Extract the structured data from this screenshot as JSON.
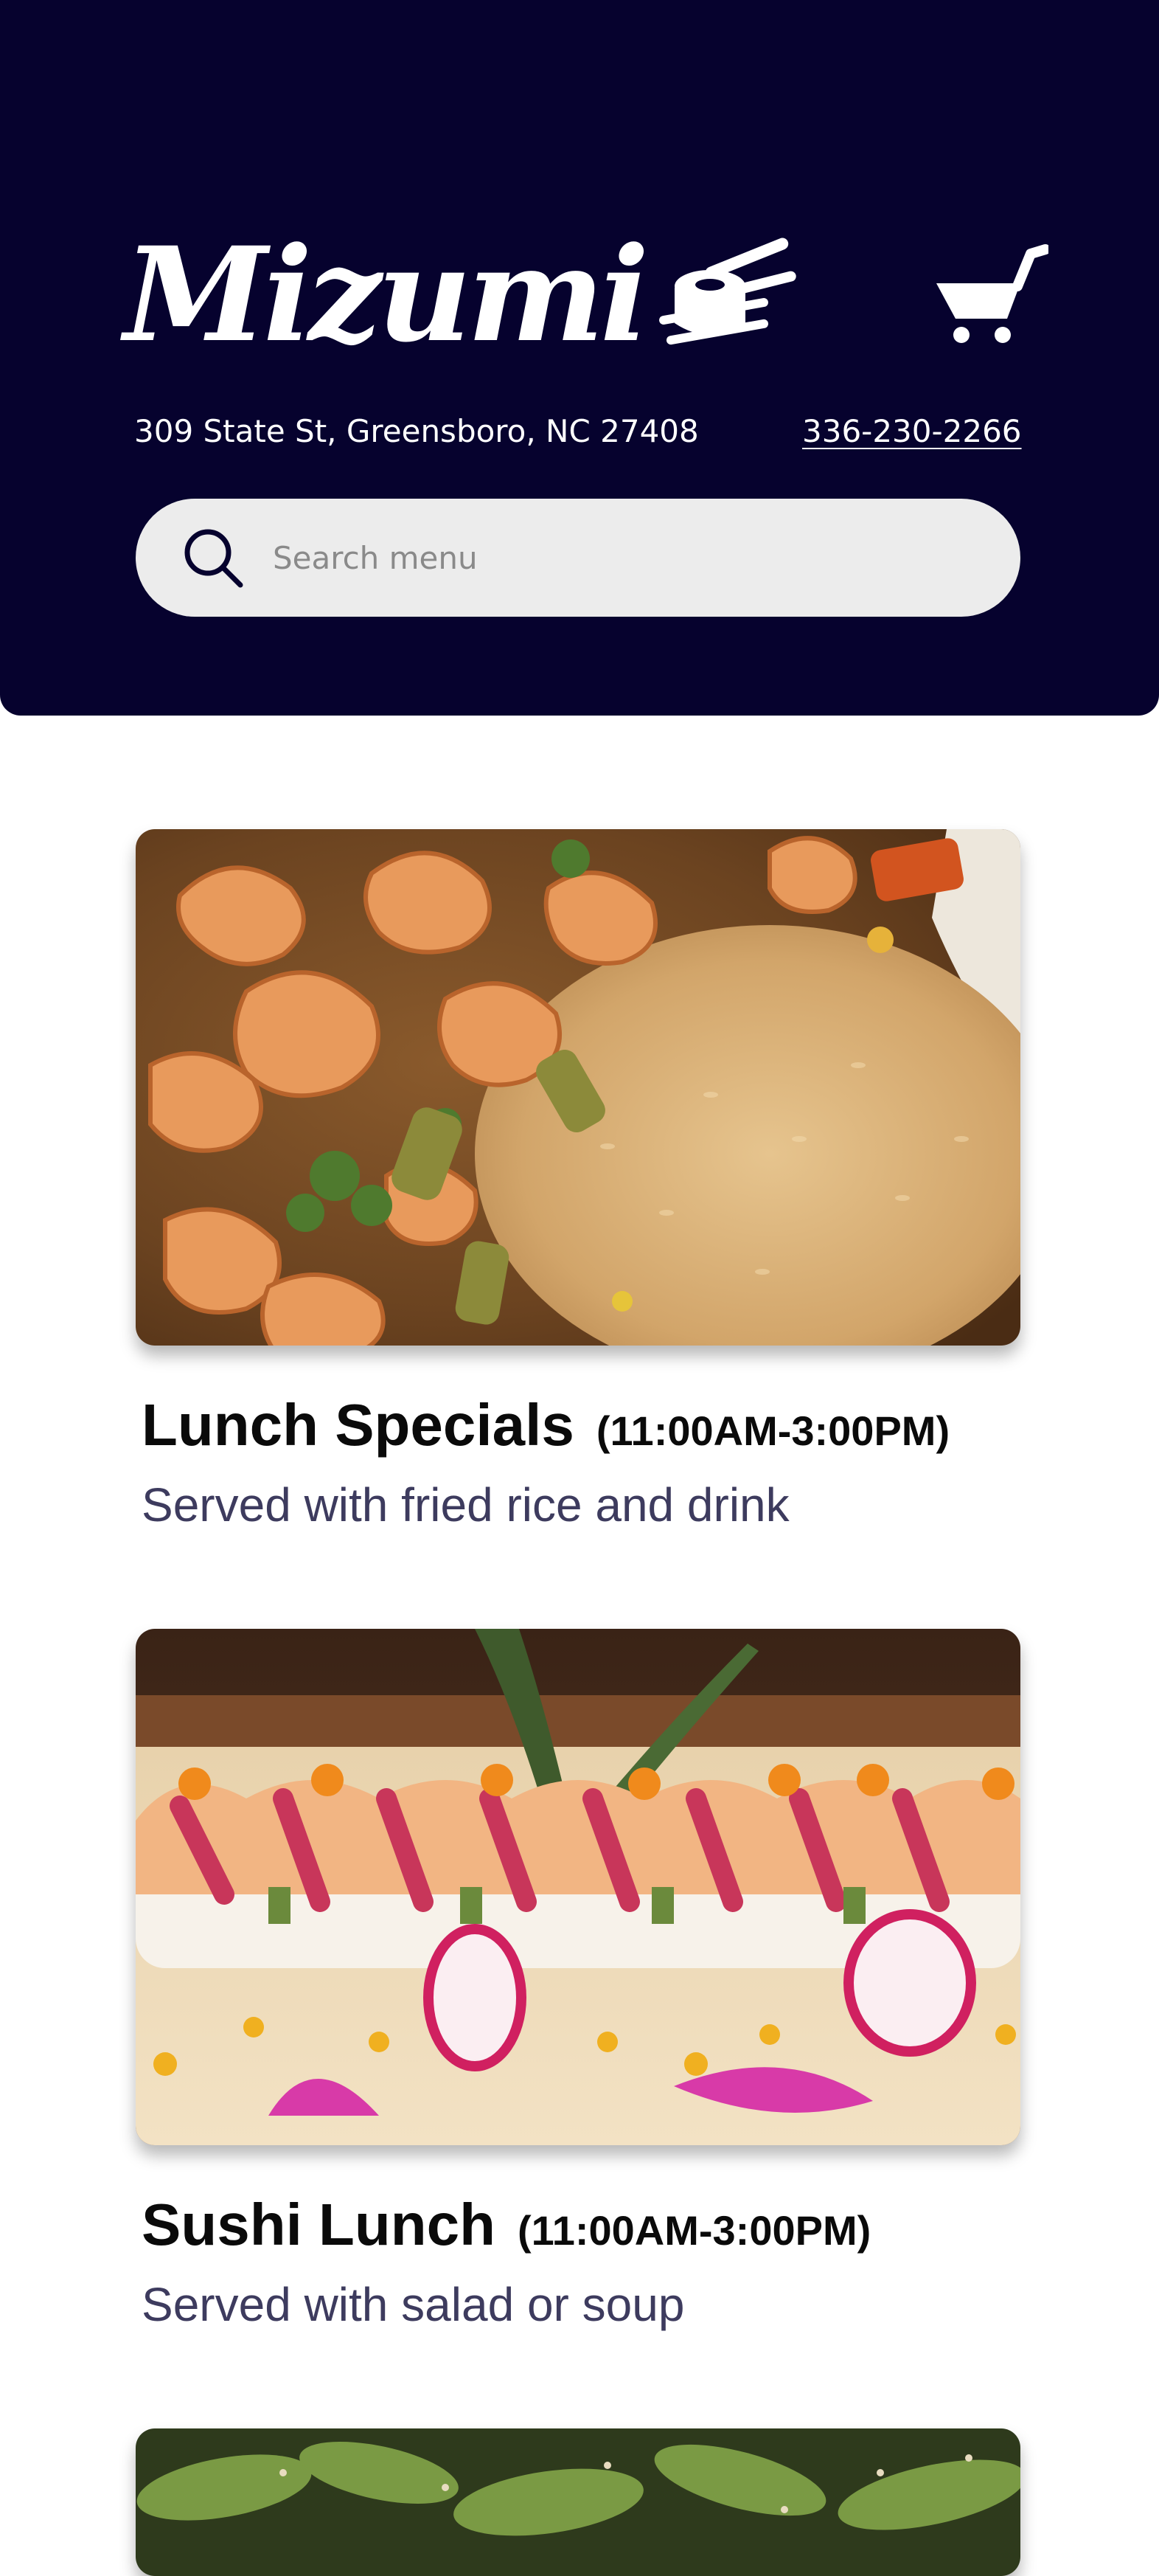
{
  "header": {
    "logo_text": "Mizumi",
    "address": "309 State St, Greensboro, NC 27408",
    "phone": "336-230-2266",
    "cart_icon": "cart-icon",
    "colors": {
      "background": "#06022e",
      "text": "#ffffff"
    }
  },
  "search": {
    "placeholder": "Search menu",
    "icon": "search-icon"
  },
  "menu": {
    "categories": [
      {
        "title": "Lunch Specials",
        "hours": "(11:00AM-3:00PM)",
        "description": "Served with fried rice and drink",
        "image": "shrimp-fried-rice-photo"
      },
      {
        "title": "Sushi Lunch",
        "hours": "(11:00AM-3:00PM)",
        "description": "Served with salad or soup",
        "image": "sushi-roll-photo"
      },
      {
        "image": "edamame-photo"
      }
    ]
  }
}
